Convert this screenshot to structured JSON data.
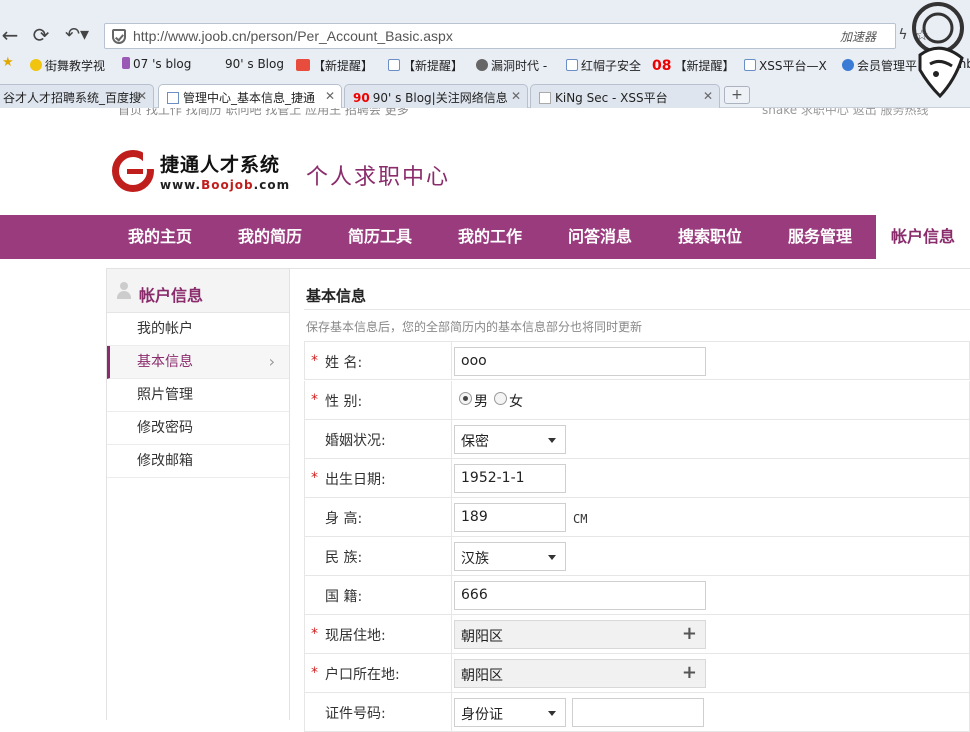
{
  "browser": {
    "url": "http://www.joob.cn/person/Per_Account_Basic.aspx",
    "accelerator_label": "加速器",
    "bookmarks": [
      "街舞教学视",
      "07 's blog",
      "90' s Blog",
      "【新提醒】",
      "【新提醒】",
      "漏洞时代 -",
      "红帽子安全",
      "【新提醒】",
      "XSS平台—X",
      "会员管理平",
      "Emb"
    ],
    "tabs": [
      {
        "title": "谷才人才招聘系统_百度搜"
      },
      {
        "title": "管理中心_基本信息_捷通"
      },
      {
        "title": "90' s Blog|关注网络信息"
      },
      {
        "title": "KiNg Sec - XSS平台"
      }
    ],
    "new_tab_label": "+"
  },
  "top_strip": {
    "left_text": "首页 找工作 找简历 职问吧 找管上 应用王 招聘会 更多",
    "right_text": "shake 求职中心 返出 服务热线"
  },
  "header": {
    "brand_name": "捷通人才系统",
    "brand_site_prefix": "www.",
    "brand_site_name": "Boojob",
    "brand_site_suffix": ".com",
    "center_title": "个人求职中心"
  },
  "main_nav": [
    "我的主页",
    "我的简历",
    "简历工具",
    "我的工作",
    "问答消息",
    "搜索职位",
    "服务管理",
    "帐户信息"
  ],
  "sidebar": {
    "title": "帐户信息",
    "items": [
      "我的帐户",
      "基本信息",
      "照片管理",
      "修改密码",
      "修改邮箱"
    ]
  },
  "form": {
    "title": "基本信息",
    "note": "保存基本信息后，您的全部简历内的基本信息部分也将同时更新",
    "required_mark": "*",
    "name_label": "姓 名:",
    "name_value": "ooo",
    "gender_label": "性 别:",
    "gender_male": "男",
    "gender_female": "女",
    "marital_label": "婚姻状况:",
    "marital_value": "保密",
    "birth_label": "出生日期:",
    "birth_value": "1952-1-1",
    "height_label": "身 高:",
    "height_value": "189",
    "height_unit": "CM",
    "ethnic_label": "民 族:",
    "ethnic_value": "汉族",
    "nationality_label": "国 籍:",
    "nationality_value": "666",
    "residence_label": "现居住地:",
    "residence_value": "朝阳区",
    "hukou_label": "户口所在地:",
    "hukou_value": "朝阳区",
    "id_label": "证件号码:",
    "id_type_value": "身份证",
    "id_number_value": ""
  }
}
